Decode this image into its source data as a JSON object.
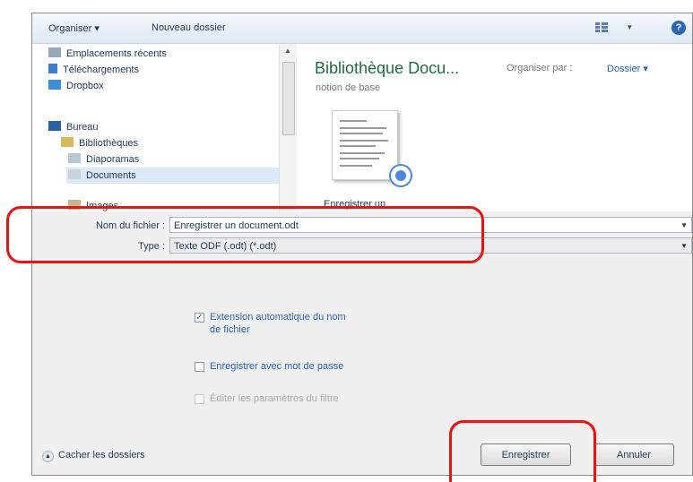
{
  "toolbar": {
    "organize_label": "Organiser ▾",
    "new_folder_label": "Nouveau dossier",
    "view_dropdown": "▾",
    "help_label": "?"
  },
  "nav": {
    "items": [
      {
        "label": "Emplacements récents",
        "icon": "recent-places-icon"
      },
      {
        "label": "Téléchargements",
        "icon": "downloads-icon"
      },
      {
        "label": "Dropbox",
        "icon": "dropbox-icon"
      },
      {
        "label": "Bureau",
        "icon": "desktop-icon"
      },
      {
        "label": "Bibliothèques",
        "icon": "libraries-icon"
      },
      {
        "label": "Diaporamas",
        "icon": "slideshows-icon"
      },
      {
        "label": "Documents",
        "icon": "documents-icon"
      },
      {
        "label": "Images",
        "icon": "images-icon"
      }
    ]
  },
  "content": {
    "title": "Bibliothèque Docu...",
    "subtitle": "notion de base",
    "arrange_label": "Organiser par :",
    "arrange_value": "Dossier ▾",
    "file": {
      "name": "Enregistrer un document.odt"
    }
  },
  "form": {
    "filename_label": "Nom du fichier :",
    "filename_value": "Enregistrer un document.odt",
    "type_label": "Type :",
    "type_value": "Texte ODF (.odt) (*.odt)"
  },
  "options": [
    {
      "label": "Extension automatique du nom de fichier",
      "checked": true,
      "enabled": true
    },
    {
      "label": "Enregistrer avec mot de passe",
      "checked": false,
      "enabled": true
    },
    {
      "label": "Éditer les paramètres du filtre",
      "checked": false,
      "enabled": false
    }
  ],
  "footer": {
    "hide_folders_label": "Cacher les dossiers",
    "save_label": "Enregistrer",
    "cancel_label": "Annuler"
  },
  "colors": {
    "highlight": "#ee1111",
    "library_title": "#1f6b40",
    "link": "#2a66b8"
  }
}
